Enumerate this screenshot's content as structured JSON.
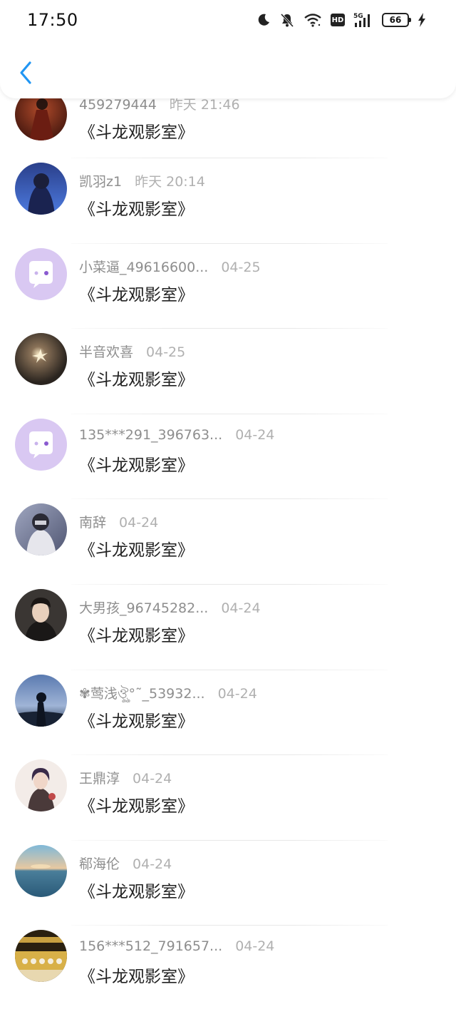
{
  "status_bar": {
    "time": "17:50",
    "battery": "66",
    "network": "5G",
    "hd": "HD",
    "icons": [
      "moon-icon",
      "bell-mute-icon",
      "wifi-icon",
      "hd-icon",
      "signal-5g-icon",
      "battery-icon",
      "charging-icon"
    ]
  },
  "header": {
    "back_icon": "chevron-left-icon",
    "accent_color": "#2196f3"
  },
  "conversations": [
    {
      "name": "459279444",
      "time": "昨天 21:46",
      "message": "《斗龙观影室》"
    },
    {
      "name": "凯羽z1",
      "time": "昨天 20:14",
      "message": "《斗龙观影室》"
    },
    {
      "name": "小菜逼_49616600...",
      "time": "04-25",
      "message": "《斗龙观影室》"
    },
    {
      "name": "半音欢喜",
      "time": "04-25",
      "message": "《斗龙观影室》"
    },
    {
      "name": "135***291_396763...",
      "time": "04-24",
      "message": "《斗龙观影室》"
    },
    {
      "name": "南辞",
      "time": "04-24",
      "message": "《斗龙观影室》"
    },
    {
      "name": "大男孩_96745282...",
      "time": "04-24",
      "message": "《斗龙观影室》"
    },
    {
      "name": "✾莺浅ঔৣ°˜_53932...",
      "time": "04-24",
      "message": "《斗龙观影室》"
    },
    {
      "name": "王鼎淳",
      "time": "04-24",
      "message": "《斗龙观影室》"
    },
    {
      "name": "郗海伦",
      "time": "04-24",
      "message": "《斗龙观影室》"
    },
    {
      "name": "156***512_791657...",
      "time": "04-24",
      "message": "《斗龙观影室》"
    }
  ]
}
